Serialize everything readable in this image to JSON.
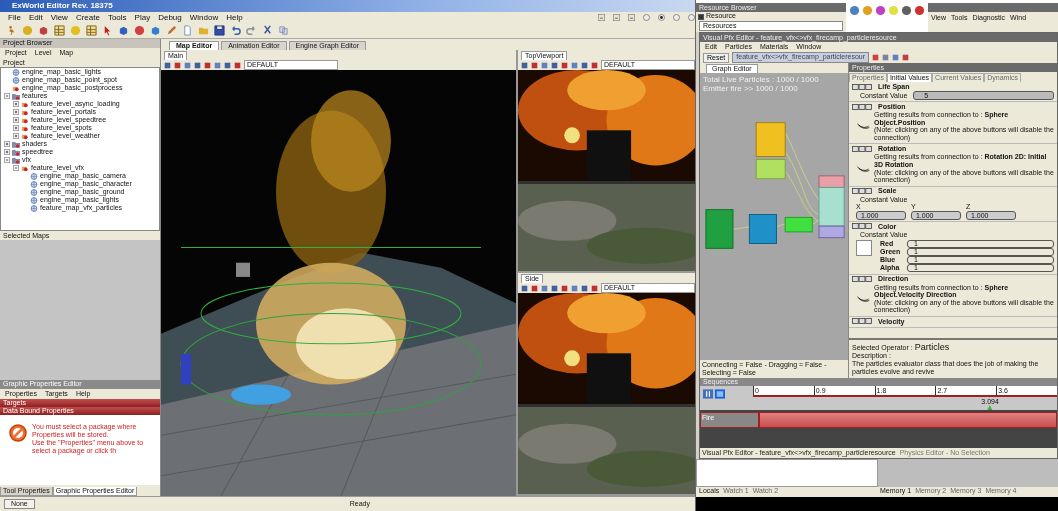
{
  "window": {
    "title": "ExWorld Editor Rev. 18375"
  },
  "menu": [
    "File",
    "Edit",
    "View",
    "Create",
    "Tools",
    "Play",
    "Debug",
    "Window",
    "Help"
  ],
  "project_browser": {
    "title": "Project Browser",
    "menu": [
      "Project",
      "Level",
      "Map"
    ],
    "header": "Project",
    "tree": [
      {
        "kind": "map",
        "label": "engine_map_basic_lights"
      },
      {
        "kind": "map",
        "label": "engine_map_basic_point_spot"
      },
      {
        "kind": "level",
        "label": "engine_map_basic_postprocess"
      },
      {
        "kind": "folder",
        "label": "features",
        "expanded": true,
        "children": [
          {
            "kind": "level",
            "label": "feature_level_async_loading",
            "expanded": false
          },
          {
            "kind": "level",
            "label": "feature_level_portals",
            "expanded": false
          },
          {
            "kind": "level",
            "label": "feature_level_speedtree",
            "expanded": false
          },
          {
            "kind": "level",
            "label": "feature_level_spots",
            "expanded": false
          },
          {
            "kind": "level",
            "label": "feature_level_weather",
            "expanded": false
          }
        ]
      },
      {
        "kind": "folder",
        "label": "shaders",
        "expanded": false
      },
      {
        "kind": "folder",
        "label": "speedtree",
        "expanded": false
      },
      {
        "kind": "folder",
        "label": "vfx",
        "expanded": true,
        "children": [
          {
            "kind": "level",
            "label": "feature_level_vfx",
            "expanded": true,
            "children": [
              {
                "kind": "map",
                "label": "engine_map_basic_camera"
              },
              {
                "kind": "map",
                "label": "engine_map_basic_character"
              },
              {
                "kind": "map",
                "label": "engine_map_basic_ground"
              },
              {
                "kind": "map",
                "label": "engine_map_basic_lights"
              },
              {
                "kind": "map",
                "label": "feature_map_vfx_particles"
              }
            ]
          }
        ]
      }
    ]
  },
  "selected_maps": {
    "title": "Selected Maps"
  },
  "graphic_properties_editor": {
    "title": "Graphic Properties Editor",
    "menu": [
      "Properties",
      "Targets",
      "Help"
    ],
    "sections": [
      "Targets",
      "Data Bound Properties"
    ],
    "message": [
      "You must select a package where Properties will be stored.",
      "Use the \"Properties\" menu above to select a package or click th"
    ]
  },
  "left_tabs": [
    {
      "label": "Tool Properties",
      "selected": false
    },
    {
      "label": "Graphic Properties Editor",
      "selected": true
    }
  ],
  "status_bar": {
    "button": "None",
    "text": "Ready"
  },
  "editor_tabs": [
    {
      "label": "Map Editor",
      "selected": true
    },
    {
      "label": "Animation Editor",
      "selected": false
    },
    {
      "label": "Engine Graph Editor",
      "selected": false
    }
  ],
  "viewports": [
    {
      "label": "Main",
      "preset": "DEFAULT"
    },
    {
      "label": "TopViewport",
      "preset": "DEFAULT"
    },
    {
      "label": "Side",
      "preset": "DEFAULT"
    }
  ],
  "resource_browser": {
    "title": "Resource Browser",
    "checkbox": {
      "label": "Resource",
      "checked": true
    },
    "field": "Resources"
  },
  "debug_window": {
    "menu": [
      "View",
      "Tools",
      "Diagnostic",
      "Wind"
    ]
  },
  "pfx_editor": {
    "title": "Visual Pfx Editor - feature_vfx<>vfx_firecamp_particleresource",
    "menu": [
      "Edit",
      "Particles",
      "Materials",
      "Window"
    ],
    "reset": "Reset",
    "resource": "feature_vfx<>vfx_firecamp_particleresour",
    "graph": {
      "tab": "Graph Editor",
      "stats": [
        "Total Live Particles : 1000 / 1000",
        "Emitter fire >> 1000 / 1000"
      ],
      "status": "Connecting = False - Dragging = False - Selecting = False"
    },
    "properties": {
      "title": "Properties",
      "tabs": [
        {
          "label": "Properties",
          "selected": false
        },
        {
          "label": "Initial Values",
          "selected": true
        },
        {
          "label": "Current Values",
          "selected": false
        },
        {
          "label": "Dynamics",
          "selected": false
        }
      ],
      "sections": [
        {
          "kind": "constant",
          "name": "Life Span",
          "label": "Constant Value",
          "value": "5"
        },
        {
          "kind": "connection",
          "name": "Position",
          "text": "Getting results from connection to : **Sphere Object.Position**",
          "note": "(Note: clicking on any of the above buttons will disable the connection)"
        },
        {
          "kind": "connection",
          "name": "Rotation",
          "text": "Getting results from connection to : **Rotation 2D: Initial 3D Rotation**",
          "note": "(Note: clicking on any of the above buttons will disable the connection)"
        },
        {
          "kind": "vector",
          "name": "Scale",
          "label": "Constant Value",
          "fields": [
            {
              "axis": "X",
              "value": "1.000"
            },
            {
              "axis": "Y",
              "value": "1.000"
            },
            {
              "axis": "Z",
              "value": "1.000"
            }
          ]
        },
        {
          "kind": "color",
          "name": "Color",
          "label": "Constant Value",
          "channels": [
            {
              "name": "Red",
              "value": "1"
            },
            {
              "name": "Green",
              "value": "1"
            },
            {
              "name": "Blue",
              "value": "1"
            },
            {
              "name": "Alpha",
              "value": "1"
            }
          ]
        },
        {
          "kind": "connection",
          "name": "Direction",
          "text": "Getting results from connection to : **Sphere Object.Velocity Direction**",
          "note": "(Note: clicking on any of the above buttons will disable the connection)"
        },
        {
          "kind": "header",
          "name": "Velocity"
        }
      ],
      "operator": {
        "label": "Selected Operator :",
        "name": "Particles",
        "description_label": "Description :",
        "description": "The particles evaluator class that does the job of making the particles evolve and revive"
      }
    },
    "sequencer": {
      "title": "Sequences",
      "ticks": [
        "0",
        "0.9",
        "1.8",
        "2.7",
        "3.6"
      ],
      "playhead": {
        "reading": "3.094",
        "level": 0.78
      },
      "tracks": [
        {
          "name": "Fire"
        }
      ]
    },
    "bottom_tabs": [
      {
        "label": "Visual Pfx Editor - feature_vfx<>vfx_firecamp_particleresource",
        "selected": true
      },
      {
        "label": "Physics Editor - No Selection",
        "selected": false
      }
    ]
  },
  "debug_tabs": {
    "left": [
      {
        "label": "Locals",
        "selected": true
      },
      {
        "label": "Watch 1",
        "selected": false
      },
      {
        "label": "Watch 2",
        "selected": false
      }
    ],
    "right": [
      {
        "label": "Memory 1",
        "selected": true
      },
      {
        "label": "Memory 2",
        "selected": false
      },
      {
        "label": "Memory 3",
        "selected": false
      },
      {
        "label": "Memory 4",
        "selected": false
      }
    ]
  }
}
